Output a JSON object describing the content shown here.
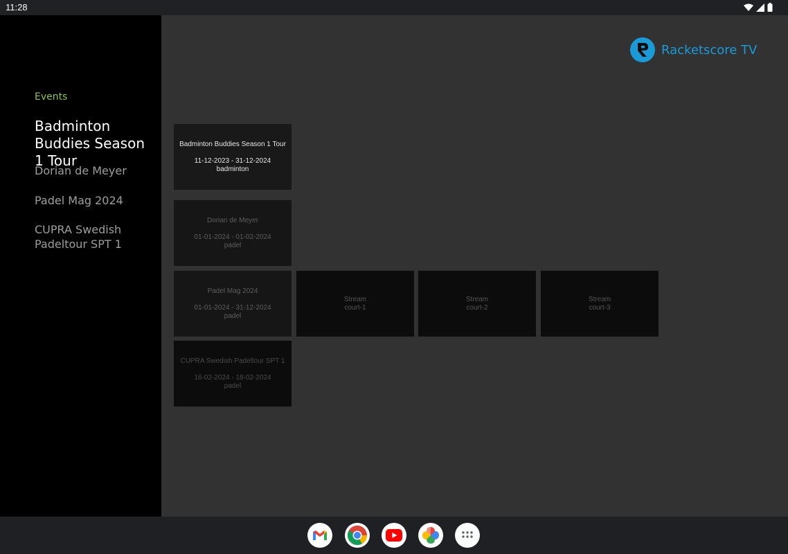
{
  "status_bar": {
    "time": "11:28",
    "icons": [
      "wifi-icon",
      "signal-icon",
      "battery-icon"
    ]
  },
  "sidebar": {
    "section_label": "Events",
    "items": [
      {
        "label": "Badminton Buddies Season 1 Tour",
        "active": true
      },
      {
        "label": "Dorian de Meyer",
        "active": false
      },
      {
        "label": "Padel Mag 2024",
        "active": false
      },
      {
        "label": "CUPRA Swedish Padeltour SPT 1",
        "active": false
      }
    ]
  },
  "brand": {
    "logo_letter": "R",
    "name": "Racketscore TV",
    "color": "#1a9bd7"
  },
  "events": [
    {
      "title": "Badminton Buddies Season 1 Tour",
      "dates": "11-12-2023 - 31-12-2024",
      "sport": "badminton"
    },
    {
      "title": "Dorian de Meyer",
      "dates": "01-01-2024 - 01-02-2024",
      "sport": "padel"
    },
    {
      "title": "Padel Mag 2024",
      "dates": "01-01-2024 - 31-12-2024",
      "sport": "padel"
    },
    {
      "title": "CUPRA Swedish Padeltour SPT 1",
      "dates": "16-02-2024 - 18-02-2024",
      "sport": "padel"
    }
  ],
  "streams": [
    {
      "label": "Stream",
      "court": "court-1"
    },
    {
      "label": "Stream",
      "court": "court-2"
    },
    {
      "label": "Stream",
      "court": "court-3"
    }
  ],
  "dock": {
    "apps": [
      "gmail-icon",
      "chrome-icon",
      "youtube-icon",
      "photos-icon",
      "app-drawer-icon"
    ]
  },
  "colors": {
    "accent_green": "#8bc34a",
    "brand_blue": "#1a9bd7",
    "background": "#323232",
    "sidebar": "#000000"
  }
}
